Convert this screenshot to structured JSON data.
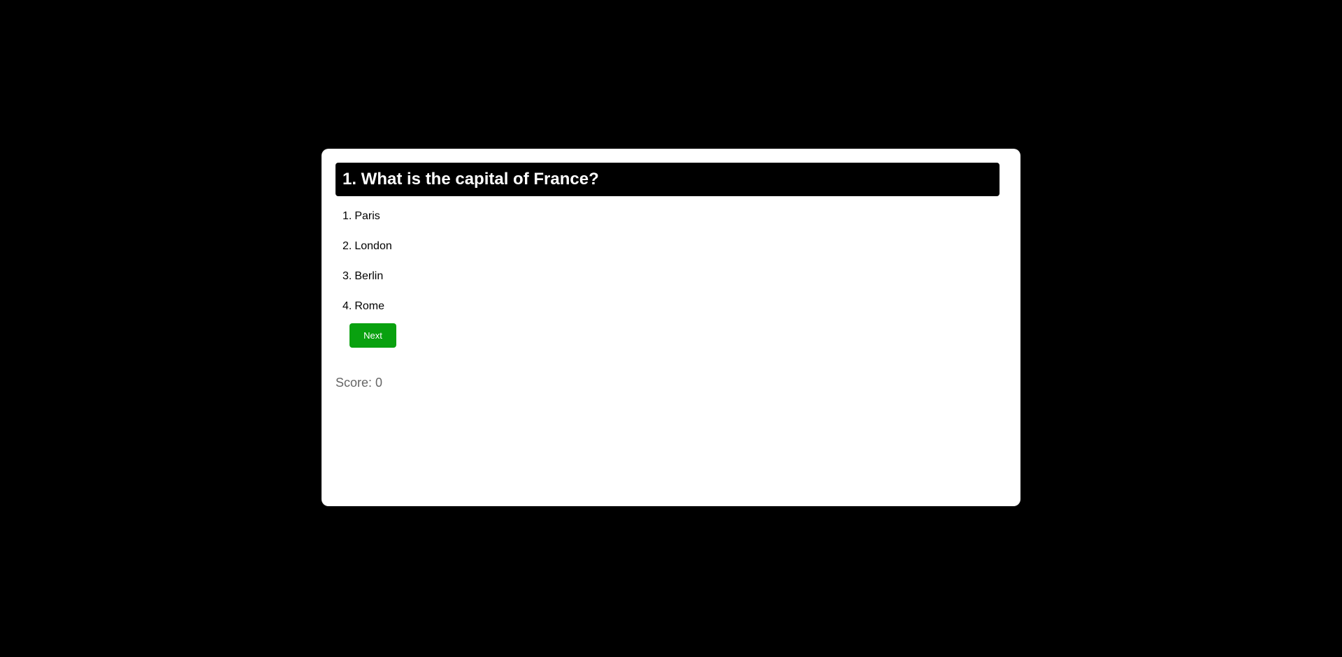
{
  "quiz": {
    "question": "1. What is the capital of France?",
    "options": [
      {
        "num": "1.",
        "label": "Paris"
      },
      {
        "num": "2.",
        "label": "London"
      },
      {
        "num": "3.",
        "label": "Berlin"
      },
      {
        "num": "4.",
        "label": "Rome"
      }
    ],
    "next_label": "Next",
    "score_text": "Score: 0"
  },
  "colors": {
    "background": "#000000",
    "card": "#ffffff",
    "question_bar": "#000000",
    "next_button": "#09a10f",
    "score_text": "#666666"
  }
}
